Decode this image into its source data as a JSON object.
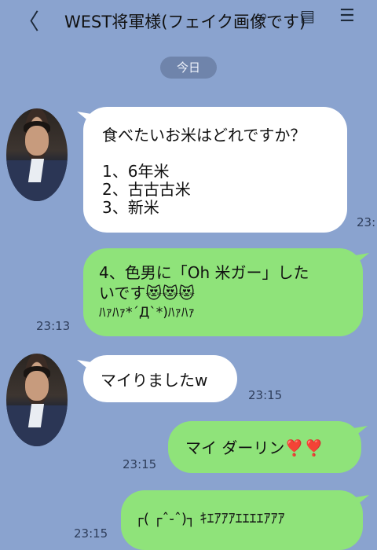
{
  "header": {
    "back_icon": "chevron-left-icon",
    "title": "WEST将軍様(フェイク画像です)",
    "icons": [
      "search-icon",
      "notes-icon",
      "menu-icon"
    ]
  },
  "date_label": "今日",
  "messages": [
    {
      "side": "left",
      "lines": [
        "食べたいお米はどれですか？",
        "",
        "1、6年米",
        "2、古古古米",
        "3、新米"
      ],
      "time": "23:"
    },
    {
      "side": "right",
      "lines": [
        "4、色男に「Oh 米ガー」した",
        "いです😻😻😻",
        "ﾊｧﾊｧ*´Д`*)ﾊｧﾊｧ"
      ],
      "time": "23:13"
    },
    {
      "side": "left",
      "lines": [
        "マイりましたw"
      ],
      "time": "23:15"
    },
    {
      "side": "right",
      "lines": [
        "マイ ダーリン❣️❣️"
      ],
      "time": "23:15"
    },
    {
      "side": "right",
      "lines": [
        "┌( ┌ˆ֊ˆ)┐ ｷｴｱｱｱｴｴｴｴｱｱｱ"
      ],
      "time": "23:15"
    }
  ]
}
